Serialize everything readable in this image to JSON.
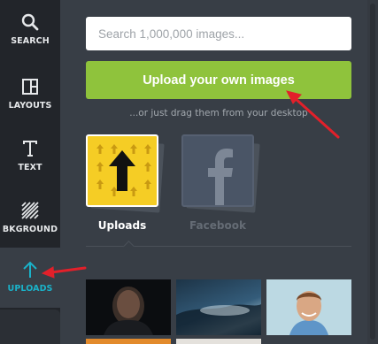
{
  "sidebar": {
    "items": [
      {
        "label": "SEARCH",
        "icon": "search-icon"
      },
      {
        "label": "LAYOUTS",
        "icon": "layouts-icon"
      },
      {
        "label": "TEXT",
        "icon": "text-icon"
      },
      {
        "label": "BKGROUND",
        "icon": "background-icon"
      },
      {
        "label": "UPLOADS",
        "icon": "upload-arrow-icon",
        "active": true
      }
    ]
  },
  "search": {
    "placeholder": "Search 1,000,000 images..."
  },
  "upload": {
    "button_label": "Upload your own images",
    "drag_hint": "...or just drag them from your desktop"
  },
  "sources": [
    {
      "label": "Uploads",
      "icon": "uploads-arrows-icon",
      "selected": true
    },
    {
      "label": "Facebook",
      "icon": "facebook-icon",
      "selected": false
    }
  ],
  "colors": {
    "accent": "#1ab2c9",
    "upload_button": "#8fc33c",
    "annotation_arrow": "#e2202a"
  }
}
